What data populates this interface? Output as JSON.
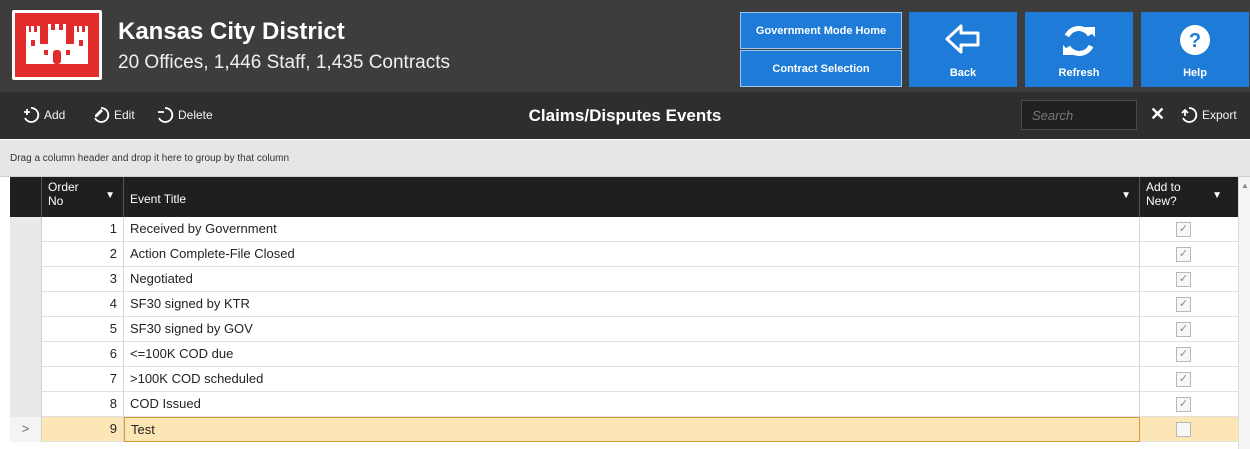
{
  "header": {
    "title": "Kansas City District",
    "subtitle": "20 Offices, 1,446 Staff, 1,435 Contracts",
    "logo_icon": "castle-icon",
    "nav": {
      "gov_mode_home": "Government Mode Home",
      "contract_selection": "Contract Selection",
      "back": "Back",
      "refresh": "Refresh",
      "help": "Help"
    }
  },
  "toolbar": {
    "add": "Add",
    "edit": "Edit",
    "delete": "Delete",
    "title": "Claims/Disputes Events",
    "search_placeholder": "Search",
    "clear": "✕",
    "export": "Export"
  },
  "group_panel": {
    "hint": "Drag a column header and drop it here to group by that column"
  },
  "grid": {
    "columns": {
      "order_line1": "Order",
      "order_line2": "No",
      "event_title": "Event Title",
      "add_line1": "Add to",
      "add_line2": "New?"
    },
    "rows": [
      {
        "order": "1",
        "title": "Received by Government",
        "add_to_new": true
      },
      {
        "order": "2",
        "title": "Action Complete-File Closed",
        "add_to_new": true
      },
      {
        "order": "3",
        "title": "Negotiated",
        "add_to_new": true
      },
      {
        "order": "4",
        "title": "SF30 signed by KTR",
        "add_to_new": true
      },
      {
        "order": "5",
        "title": "SF30 signed by GOV",
        "add_to_new": true
      },
      {
        "order": "6",
        "title": "<=100K COD due",
        "add_to_new": true
      },
      {
        "order": "7",
        "title": ">100K COD scheduled",
        "add_to_new": true
      },
      {
        "order": "8",
        "title": "COD Issued",
        "add_to_new": true
      },
      {
        "order": "9",
        "title": "Test",
        "add_to_new": false
      }
    ],
    "current_row_indicator": ">"
  },
  "colors": {
    "accent": "#1e7bd8",
    "header_bg": "#3d3d3d",
    "logo_red": "#e22b2b",
    "current_row": "#fde6b6"
  }
}
